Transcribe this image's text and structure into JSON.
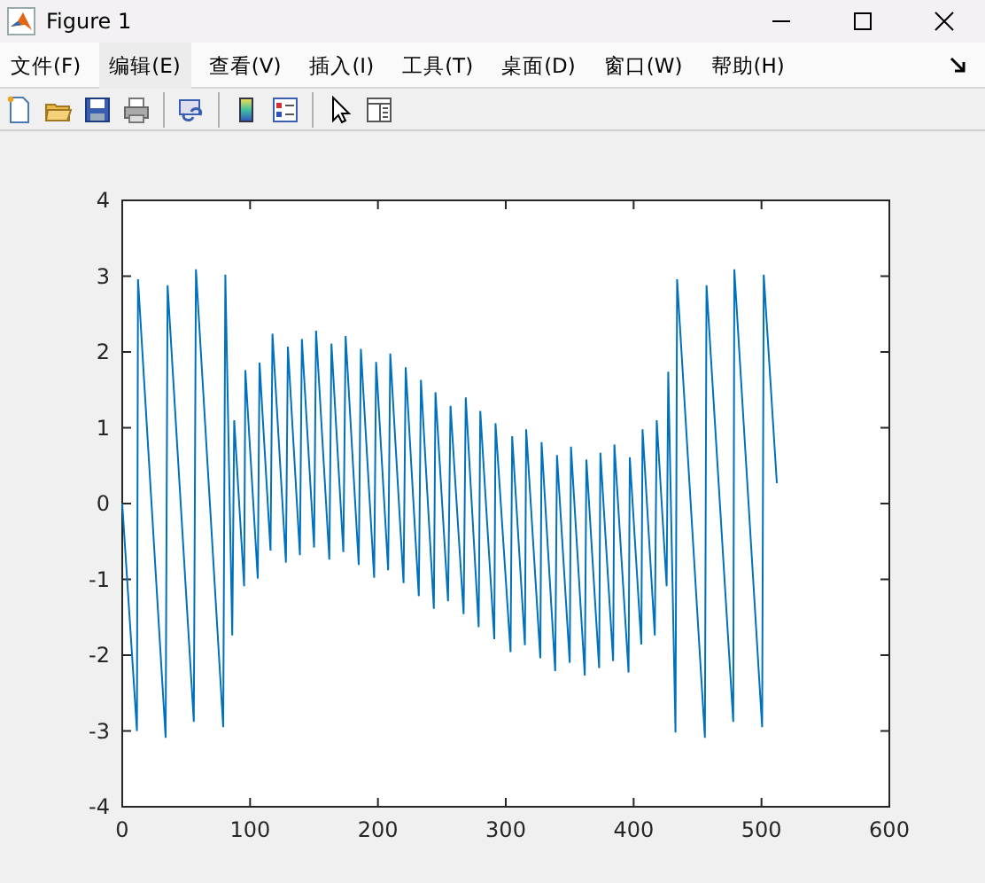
{
  "window": {
    "title": "Figure 1"
  },
  "menu": [
    {
      "label": "文件(F)",
      "highlighted": false
    },
    {
      "label": "编辑(E)",
      "highlighted": true
    },
    {
      "label": "查看(V)",
      "highlighted": false
    },
    {
      "label": "插入(I)",
      "highlighted": false
    },
    {
      "label": "工具(T)",
      "highlighted": false
    },
    {
      "label": "桌面(D)",
      "highlighted": false
    },
    {
      "label": "窗口(W)",
      "highlighted": false
    },
    {
      "label": "帮助(H)",
      "highlighted": false
    }
  ],
  "toolbar": [
    {
      "kind": "new"
    },
    {
      "kind": "open"
    },
    {
      "kind": "save"
    },
    {
      "kind": "print"
    },
    {
      "kind": "separator"
    },
    {
      "kind": "link"
    },
    {
      "kind": "separator"
    },
    {
      "kind": "colorbar"
    },
    {
      "kind": "legend"
    },
    {
      "kind": "separator"
    },
    {
      "kind": "pointer"
    },
    {
      "kind": "panel"
    }
  ],
  "plot": {
    "chart_data": {
      "type": "line",
      "x": [
        0,
        11.5,
        12.4,
        34,
        35.5,
        56,
        57.6,
        79,
        80.6,
        86,
        87.6,
        95.4,
        96.3,
        106,
        107.4,
        116,
        117.5,
        128,
        129.5,
        139,
        140.5,
        150,
        151.6,
        162,
        163.6,
        173,
        174.7,
        185,
        186.6,
        197,
        198.6,
        208,
        209.7,
        220,
        221.7,
        232,
        233.6,
        243.8,
        245,
        254.8,
        256.7,
        267,
        268.7,
        278.8,
        280,
        291,
        292,
        303.7,
        305,
        315,
        316,
        327,
        328,
        338.7,
        340,
        350,
        351,
        361.8,
        363,
        373,
        374,
        384,
        385,
        396,
        397,
        406,
        407,
        416.6,
        418,
        425.8,
        427,
        432.7,
        434,
        455.8,
        457,
        477.9,
        478.8,
        500.5,
        501.8,
        512
      ],
      "series": [
        {
          "color": "#0072bd",
          "values": [
            0,
            -3.0,
            2.96,
            -3.09,
            2.88,
            -2.88,
            3.09,
            -2.95,
            3.02,
            -1.74,
            1.1,
            -1.09,
            1.76,
            -0.99,
            1.86,
            -0.62,
            2.24,
            -0.78,
            2.07,
            -0.68,
            2.17,
            -0.58,
            2.28,
            -0.74,
            2.11,
            -0.64,
            2.21,
            -0.81,
            2.04,
            -0.98,
            1.87,
            -0.88,
            1.98,
            -1.05,
            1.8,
            -1.22,
            1.63,
            -1.39,
            1.47,
            -1.29,
            1.29,
            -1.46,
            1.4,
            -1.63,
            1.22,
            -1.79,
            1.06,
            -1.96,
            0.89,
            -1.87,
            0.98,
            -2.04,
            0.81,
            -2.21,
            0.64,
            -2.1,
            0.75,
            -2.27,
            0.58,
            -2.17,
            0.67,
            -2.08,
            0.78,
            -2.23,
            0.61,
            -1.86,
            0.98,
            -1.74,
            1.1,
            -1.09,
            1.74,
            -3.02,
            2.96,
            -3.09,
            2.88,
            -2.88,
            3.09,
            -2.95,
            3.02,
            0.27
          ]
        }
      ],
      "xlim": [
        0,
        600
      ],
      "ylim": [
        -4,
        4
      ],
      "xticks": [
        0,
        100,
        200,
        300,
        400,
        500,
        600
      ],
      "yticks": [
        -4,
        -3,
        -2,
        -1,
        0,
        1,
        2,
        3,
        4
      ]
    }
  }
}
